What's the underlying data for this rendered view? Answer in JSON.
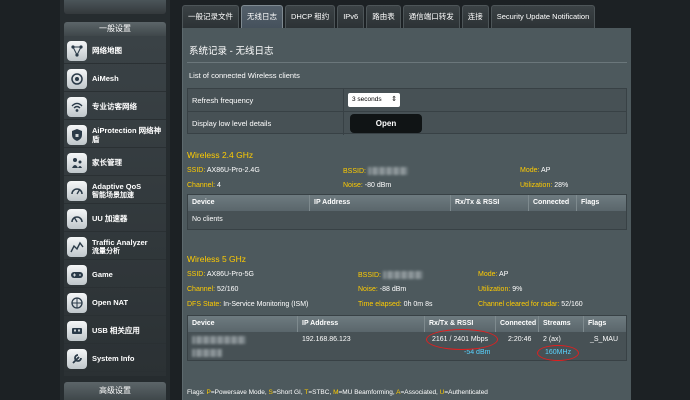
{
  "sidebar": {
    "header": "一般设置",
    "footer": "高级设置",
    "items": [
      {
        "label": "网络地图",
        "sub": "",
        "icon": "network-map-icon"
      },
      {
        "label": "AiMesh",
        "sub": "",
        "icon": "aimesh-icon"
      },
      {
        "label": "专业访客网络",
        "sub": "",
        "icon": "guest-network-icon"
      },
      {
        "label": "AiProtection 网络神盾",
        "sub": "",
        "icon": "aiprotection-icon"
      },
      {
        "label": "家长管理",
        "sub": "",
        "icon": "parental-control-icon"
      },
      {
        "label": "Adaptive QoS",
        "sub": "智能场景加速",
        "icon": "qos-icon"
      },
      {
        "label": "UU 加速器",
        "sub": "",
        "icon": "uu-accelerator-icon"
      },
      {
        "label": "Traffic Analyzer",
        "sub": "流量分析",
        "icon": "traffic-analyzer-icon"
      },
      {
        "label": "Game",
        "sub": "",
        "icon": "game-controller-icon"
      },
      {
        "label": "Open NAT",
        "sub": "",
        "icon": "open-nat-icon"
      },
      {
        "label": "USB 相关应用",
        "sub": "",
        "icon": "usb-icon"
      },
      {
        "label": "System Info",
        "sub": "",
        "icon": "system-info-icon"
      }
    ]
  },
  "tabs": [
    {
      "label": "一般记录文件",
      "active": false
    },
    {
      "label": "无线日志",
      "active": true
    },
    {
      "label": "DHCP 租约",
      "active": false
    },
    {
      "label": "IPv6",
      "active": false
    },
    {
      "label": "路由表",
      "active": false
    },
    {
      "label": "通信端口转发",
      "active": false
    },
    {
      "label": "连接",
      "active": false
    },
    {
      "label": "Security Update Notification",
      "active": false
    }
  ],
  "page": {
    "title": "系统记录 - 无线日志",
    "subtitle": "List of connected Wireless clients",
    "refresh_label": "Refresh frequency",
    "refresh_value": "3 seconds",
    "low_level_label": "Display low level details",
    "open_button": "Open"
  },
  "band24": {
    "title": "Wireless 2.4 GHz",
    "ssid_label": "SSID:",
    "ssid": "AX86U-Pro-2.4G",
    "bssid_label": "BSSID:",
    "mode_label": "Mode:",
    "mode": "AP",
    "channel_label": "Channel:",
    "channel": "4",
    "noise_label": "Noise:",
    "noise": "-80 dBm",
    "util_label": "Utilization:",
    "util": "28%",
    "columns": [
      "Device",
      "IP Address",
      "Rx/Tx & RSSI",
      "Connected",
      "Flags"
    ],
    "empty": "No clients"
  },
  "band5": {
    "title": "Wireless 5 GHz",
    "ssid_label": "SSID:",
    "ssid": "AX86U-Pro-5G",
    "bssid_label": "BSSID:",
    "mode_label": "Mode:",
    "mode": "AP",
    "channel_label": "Channel:",
    "channel": "52/160",
    "noise_label": "Noise:",
    "noise": "-88 dBm",
    "util_label": "Utilization:",
    "util": "9%",
    "dfs_label": "DFS State:",
    "dfs": "In-Service Monitoring (ISM)",
    "elapsed_label": "Time elapsed:",
    "elapsed": "0h 0m 8s",
    "cleared_label": "Channel cleared for radar:",
    "cleared": "52/160",
    "columns": [
      "Device",
      "IP Address",
      "Rx/Tx & RSSI",
      "Connected",
      "Streams",
      "Flags"
    ],
    "client": {
      "ip": "192.168.86.123",
      "rate": "2161 / 2401 Mbps",
      "rssi": "-54 dBm",
      "connected": "2:20:46",
      "streams": "2 (ax)",
      "bandwidth": "160MHz",
      "flags": "_S_MAU"
    }
  },
  "legend": {
    "prefix": "Flags:",
    "items": [
      {
        "key": "P",
        "text": "=Powersave Mode, "
      },
      {
        "key": "S",
        "text": "=Short GI, "
      },
      {
        "key": "T",
        "text": "=STBC, "
      },
      {
        "key": "M",
        "text": "=MU Beamforming, "
      },
      {
        "key": "A",
        "text": "=Associated, "
      },
      {
        "key": "U",
        "text": "=Authenticated"
      }
    ]
  },
  "colors": {
    "accent_yellow": "#ffcc00",
    "rssi_blue": "#58d3ff",
    "highlight_red": "#e02020"
  }
}
